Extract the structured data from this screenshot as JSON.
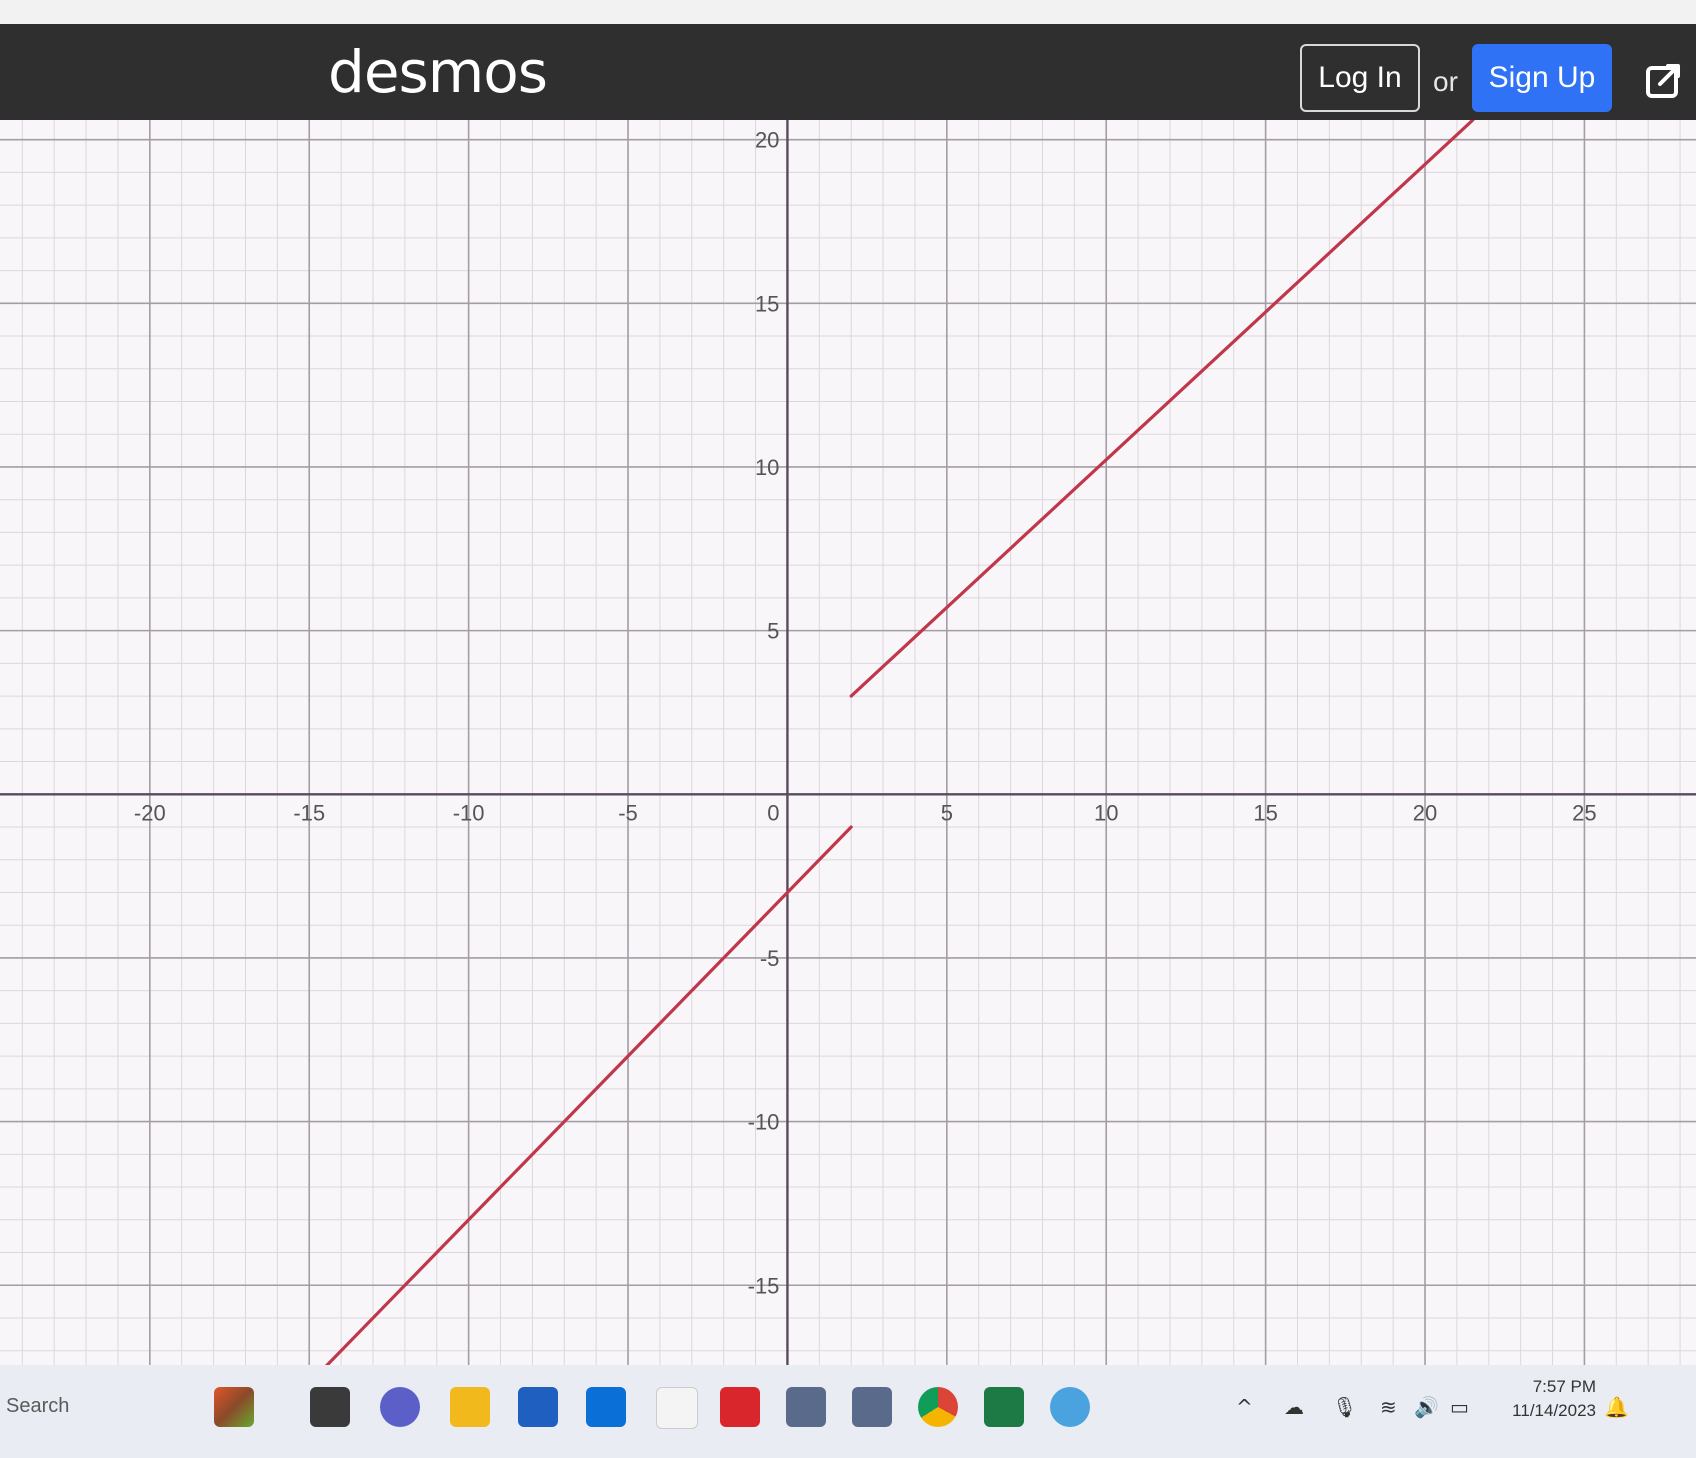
{
  "header": {
    "logo": "desmos",
    "login_label": "Log In",
    "or_label": "or",
    "signup_label": "Sign Up",
    "signup_color": "#2f72f5"
  },
  "graph": {
    "x_ticks": [
      "-20",
      "-15",
      "-10",
      "-5",
      "0",
      "5",
      "10",
      "15",
      "20",
      "25"
    ],
    "y_ticks": [
      "20",
      "15",
      "10",
      "5",
      "-5",
      "-10",
      "-15"
    ],
    "x_range": [
      -24.7,
      28.5
    ],
    "y_range": [
      -18.2,
      20.6
    ],
    "minor_grid_step": 1,
    "major_grid_step": 5,
    "curve_color": "#c0364a",
    "segments": [
      {
        "from": [
          -15.2,
          -18.2
        ],
        "to": [
          2,
          -1
        ]
      },
      {
        "from": [
          2,
          3
        ],
        "to": [
          21.5,
          20.6
        ]
      }
    ]
  },
  "taskbar": {
    "search_label": "Search",
    "time": "7:57 PM",
    "date": "11/14/2023",
    "icons": [
      "widgets-icon",
      "task-view-icon",
      "meet-icon",
      "file-explorer-icon",
      "store-icon",
      "cortana-icon",
      "notepad-icon",
      "security-app-icon",
      "app-icon-1",
      "app-icon-2",
      "chrome-icon",
      "excel-icon",
      "paint-icon"
    ]
  }
}
